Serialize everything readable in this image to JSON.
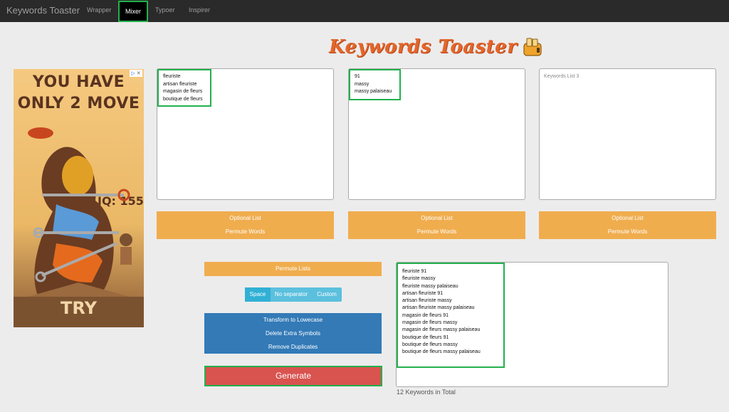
{
  "navbar": {
    "brand": "Keywords Toaster",
    "links": [
      "Wrapper",
      "Mixer",
      "Typoer",
      "Inspirer"
    ],
    "active": "Mixer"
  },
  "header": {
    "logo_text": "Keywords Toaster"
  },
  "ad": {
    "headline_1": "YOU HAVE",
    "headline_2": "ONLY 2 MOVE",
    "iq": "IQ: 155",
    "cta": "TRY"
  },
  "lists": [
    {
      "lines": [
        "fleuriste",
        "artisan fleuriste",
        "magasin de fleurs",
        "boutique de fleurs"
      ],
      "placeholder": "",
      "optional_label": "Optional List",
      "permute_label": "Permute Words"
    },
    {
      "lines": [
        "91",
        "massy",
        "massy palaiseau"
      ],
      "placeholder": "",
      "optional_label": "Optional List",
      "permute_label": "Permute Words"
    },
    {
      "lines": [],
      "placeholder": "Keywords List 3",
      "optional_label": "Optional List",
      "permute_label": "Permute Words"
    }
  ],
  "controls": {
    "permute_lists": "Permute Lists",
    "separators": [
      "Space",
      "No separator",
      "Custom"
    ],
    "active_separator": "Space",
    "transform_lowercase": "Transform to Lowecase",
    "delete_symbols": "Delete Extra Symbols",
    "remove_duplicates": "Remove Duplicates",
    "generate": "Generate"
  },
  "results": {
    "lines": [
      "fleuriste 91",
      "fleuriste massy",
      "fleuriste massy palaiseau",
      "artisan fleuriste 91",
      "artisan fleuriste massy",
      "artisan fleuriste massy palaiseau",
      "magasin de fleurs 91",
      "magasin de fleurs massy",
      "magasin de fleurs massy palaiseau",
      "boutique de fleurs 91",
      "boutique de fleurs massy",
      "boutique de fleurs massy palaiseau"
    ],
    "total_text": "12 Keywords in Total"
  },
  "colors": {
    "navbar": "#2a2a2a",
    "highlight": "#22b14c",
    "orange": "#f0ad4e",
    "blue": "#337ab7",
    "info": "#5bc0de",
    "danger": "#d9534f",
    "logo": "#e3662b"
  }
}
